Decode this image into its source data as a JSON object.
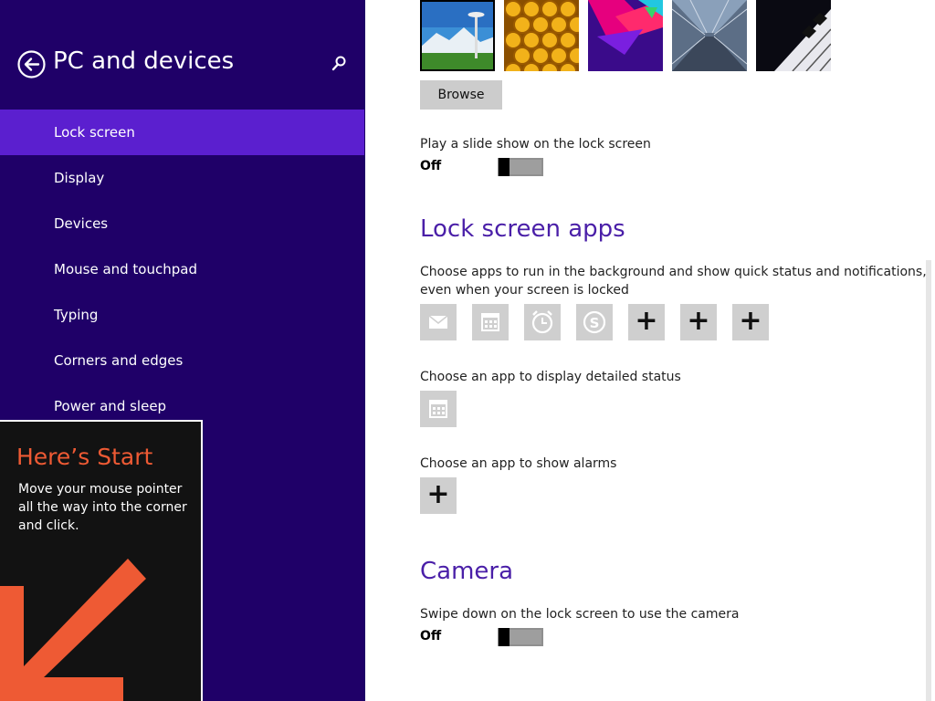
{
  "sidebar": {
    "title": "PC and devices",
    "items": [
      {
        "label": "Lock screen",
        "selected": true
      },
      {
        "label": "Display"
      },
      {
        "label": "Devices"
      },
      {
        "label": "Mouse and touchpad"
      },
      {
        "label": "Typing"
      },
      {
        "label": "Corners and edges"
      },
      {
        "label": "Power and sleep"
      }
    ]
  },
  "tip": {
    "title": "Here’s Start",
    "body": "Move your mouse pointer all the way into the corner and click."
  },
  "background": {
    "thumbnails": [
      "space-needle-landscape",
      "honeycomb",
      "colorful-shapes",
      "tunnel",
      "piano-keys"
    ],
    "browse_label": "Browse",
    "slideshow_label": "Play a slide show on the lock screen",
    "slideshow_state": "Off"
  },
  "lock_screen_apps": {
    "title": "Lock screen apps",
    "description_line1": "Choose apps to run in the background and show quick status and notifications,",
    "description_line2": "even when your screen is locked",
    "apps": [
      "mail-icon",
      "calendar-icon",
      "alarm-icon",
      "skype-icon",
      "plus-icon",
      "plus-icon",
      "plus-icon"
    ],
    "detailed_label": "Choose an app to display detailed status",
    "detailed_app": "calendar-icon",
    "alarms_label": "Choose an app to show alarms",
    "alarms_app": "plus-icon",
    "plus_glyph": "+"
  },
  "camera": {
    "title": "Camera",
    "label": "Swipe down on the lock screen to use the camera",
    "state": "Off"
  },
  "colors": {
    "sidebar_bg": "#1f0068",
    "selected_item": "#5b1fcf",
    "accent_heading": "#4a1fa8",
    "tip_title": "#ee5a34"
  }
}
